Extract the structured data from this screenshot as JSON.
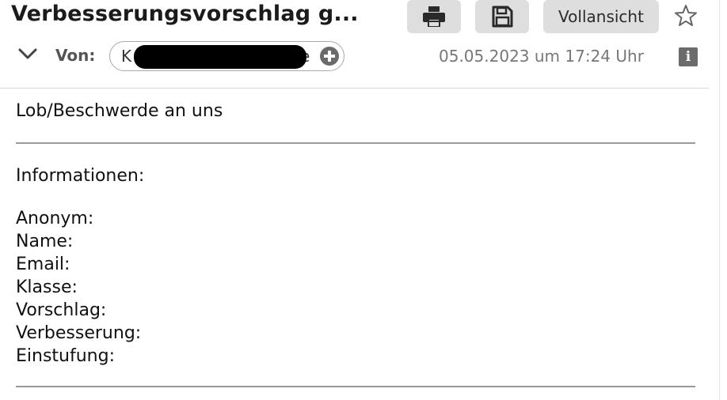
{
  "header": {
    "subject": "Verbesserungsvorschlag g...",
    "full_view_label": "Vollansicht",
    "from_label": "Von:",
    "sender_visible_start": "K",
    "sender_visible_end": "e",
    "date": "05.05.2023 um 17:24 Uhr",
    "info_glyph": "i",
    "icons": {
      "print": "printer-icon",
      "save": "save-icon",
      "star": "star-icon",
      "expand": "chevron-down-icon",
      "add_contact": "plus-circle-icon"
    }
  },
  "body": {
    "intro": "Lob/Beschwerde an uns",
    "section_title": "Informationen:",
    "fields": [
      {
        "label": "Anonym:"
      },
      {
        "label": "Name:"
      },
      {
        "label": "Email:"
      },
      {
        "label": "Klasse:"
      },
      {
        "label": "Vorschlag:"
      },
      {
        "label": "Verbesserung:"
      },
      {
        "label": "Einstufung:"
      }
    ]
  },
  "colors": {
    "button_bg": "#dedede",
    "redaction": "#000000",
    "muted_text": "#777777"
  }
}
